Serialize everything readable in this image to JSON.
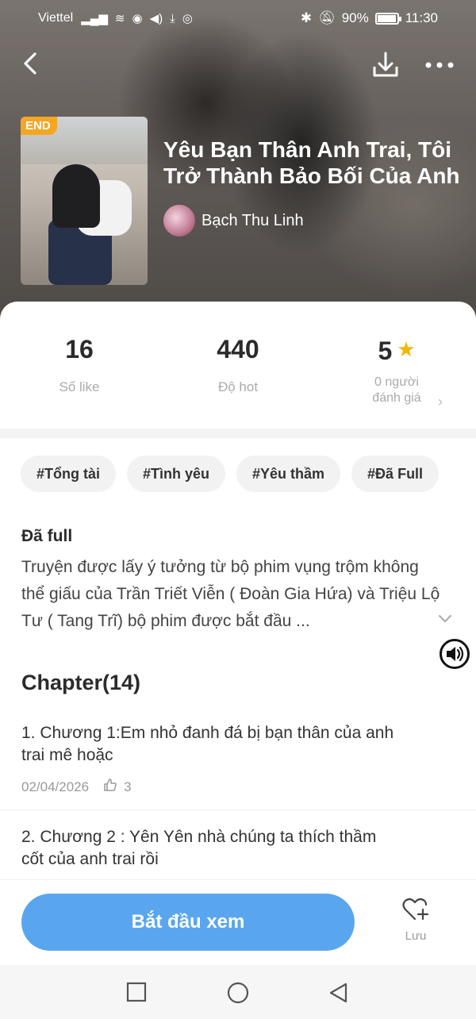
{
  "status_bar": {
    "carrier": "Viettel",
    "battery": "90%",
    "battery_level": 0.9,
    "time": "11:30"
  },
  "book": {
    "badge": "END",
    "title": "Yêu Bạn Thân Anh Trai, Tôi Trở Thành Bảo Bối Của Anh",
    "author": "Bạch Thu Linh"
  },
  "stats": {
    "likes": {
      "value": "16",
      "label": "Số like"
    },
    "hot": {
      "value": "440",
      "label": "Độ hot"
    },
    "rating": {
      "value": "5",
      "label_line1": "0 người",
      "label_line2": "đánh giá"
    }
  },
  "tags": [
    "#Tổng tài",
    "#Tình yêu",
    "#Yêu thầm",
    "#Đã Full"
  ],
  "description": {
    "heading": "Đã full",
    "text": "Truyện được  lấy ý tưởng từ bộ phim vụng trộm không thể giấu của Trần Triết Viễn ( Đoàn Gia Hứa) và Triệu Lộ Tư ( Tang Trĩ) bộ phim được bắt đầu ..."
  },
  "chapters_header": "Chapter(14)",
  "chapters": [
    {
      "title": "1. Chương 1:Em nhỏ đanh đá bị bạn thân của anh trai mê hoặc",
      "date": "02/04/2026",
      "likes": "3"
    },
    {
      "title": "2. Chương 2 : Yên Yên nhà chúng ta thích thầm cốt của anh trai rồi",
      "date": "",
      "likes": ""
    }
  ],
  "actions": {
    "start_label": "Bắt đầu xem",
    "save_label": "Lưu"
  },
  "colors": {
    "accent": "#5aa6ee",
    "badge": "#f5a623",
    "star": "#f5b400"
  }
}
